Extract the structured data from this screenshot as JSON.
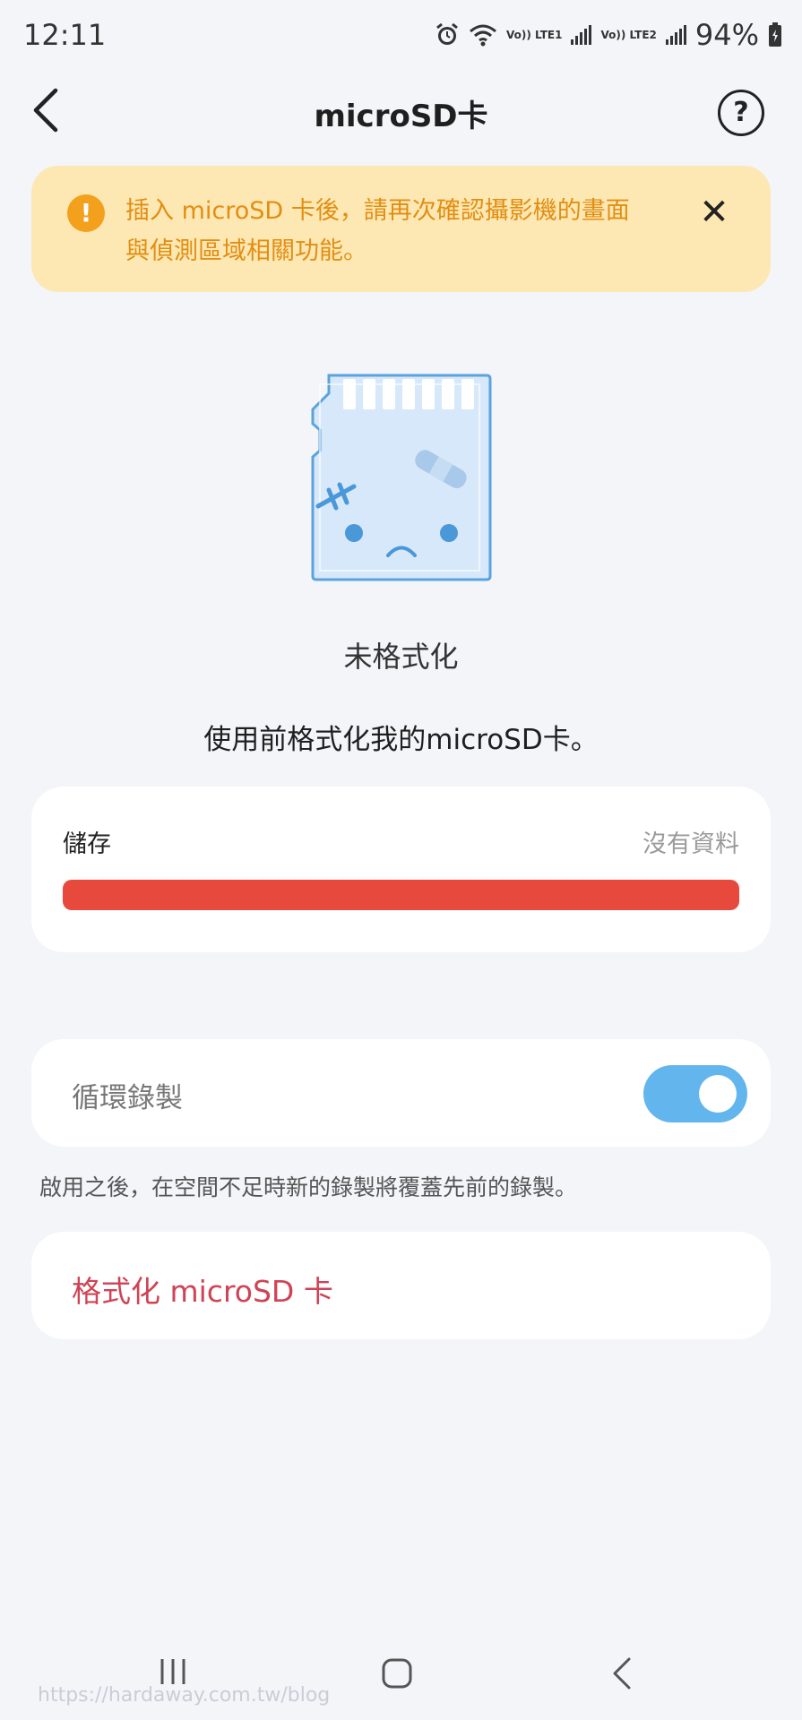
{
  "status_bar": {
    "time": "12:11",
    "lte1": "Vo)) LTE1",
    "lte2": "Vo)) LTE2",
    "battery": "94%"
  },
  "header": {
    "title": "microSD卡",
    "help_symbol": "?"
  },
  "alert": {
    "icon_symbol": "!",
    "message": "插入 microSD 卡後，請再次確認攝影機的畫面與偵測區域相關功能。",
    "close_symbol": "✕"
  },
  "card_status": {
    "title": "未格式化",
    "description": "使用前格式化我的microSD卡。"
  },
  "storage": {
    "label": "儲存",
    "value": "沒有資料",
    "bar_color": "#e7493c"
  },
  "loop_recording": {
    "label": "循環錄製",
    "enabled": true,
    "hint": "啟用之後，在空間不足時新的錄製將覆蓋先前的錄製。"
  },
  "format_button": {
    "label": "格式化 microSD 卡"
  },
  "watermark": "https://hardaway.com.tw/blog",
  "colors": {
    "alert_bg": "#fde8b4",
    "alert_text": "#e28e12",
    "toggle_on": "#63b5ed",
    "danger": "#cf4355"
  }
}
